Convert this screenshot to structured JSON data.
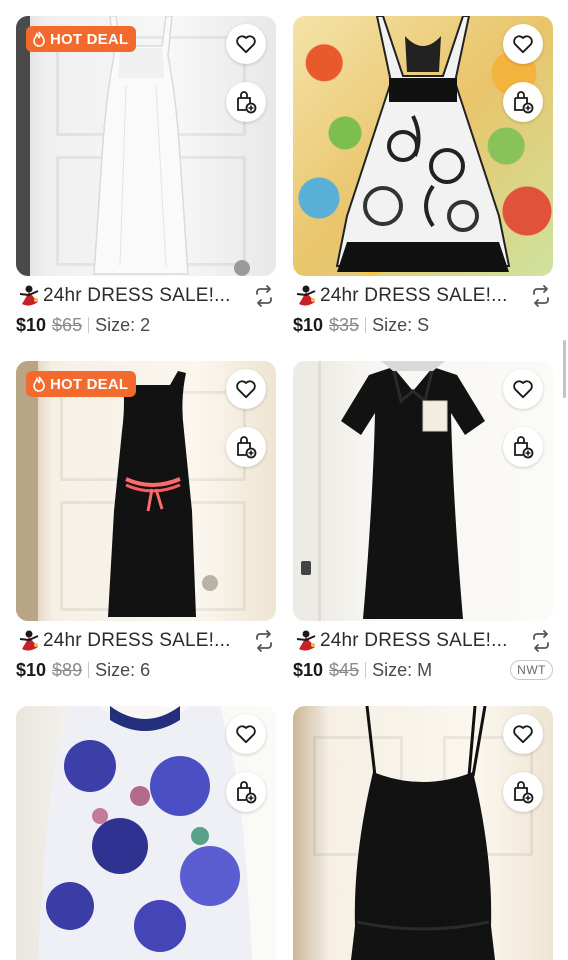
{
  "listings": [
    {
      "badge": "HOT DEAL",
      "title": "24hr DRESS SALE!...",
      "price": "$10",
      "original_price": "$65",
      "size": "Size: 2",
      "tag": ""
    },
    {
      "badge": "",
      "title": "24hr DRESS SALE!...",
      "price": "$10",
      "original_price": "$35",
      "size": "Size: S",
      "tag": ""
    },
    {
      "badge": "HOT DEAL",
      "title": "24hr DRESS SALE!...",
      "price": "$10",
      "original_price": "$89",
      "size": "Size: 6",
      "tag": ""
    },
    {
      "badge": "",
      "title": "24hr DRESS SALE!...",
      "price": "$10",
      "original_price": "$45",
      "size": "Size: M",
      "tag": "NWT"
    }
  ],
  "colors": {
    "badge": "#f26a2e",
    "text": "#1a1a1a",
    "muted": "#8a8a8a"
  },
  "icons": {
    "like": "heart-icon",
    "bag": "shopping-bag-plus-icon",
    "share": "share-icon",
    "flame": "flame-icon",
    "avatar": "seller-avatar-icon"
  }
}
